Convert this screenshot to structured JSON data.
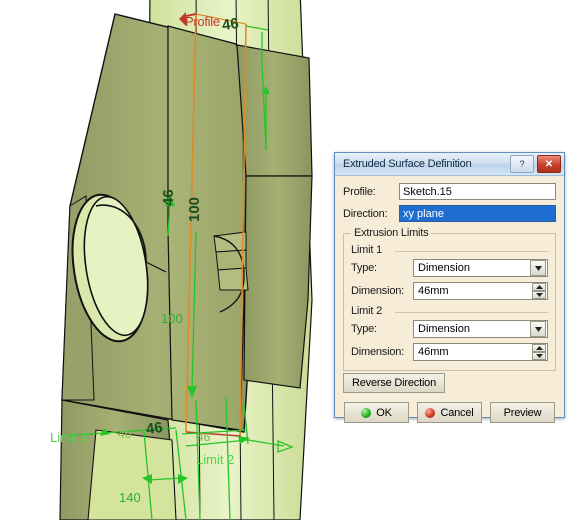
{
  "dialog": {
    "title": "Extruded Surface Definition",
    "help_label": "?",
    "close_label": "✕",
    "profile_label": "Profile:",
    "profile_value": "Sketch.15",
    "direction_label": "Direction:",
    "direction_value": "xy plane",
    "limits_legend": "Extrusion Limits",
    "limit1": {
      "heading": "Limit 1",
      "type_label": "Type:",
      "type_value": "Dimension",
      "dimension_label": "Dimension:",
      "dimension_value": "46mm"
    },
    "limit2": {
      "heading": "Limit 2",
      "type_label": "Type:",
      "type_value": "Dimension",
      "dimension_label": "Dimension:",
      "dimension_value": "46mm"
    },
    "reverse_label": "Reverse Direction",
    "ok_label": "OK",
    "cancel_label": "Cancel",
    "preview_label": "Preview"
  },
  "viewport": {
    "annotations": {
      "profile": "Profile",
      "limit1": "Limit 1",
      "limit2": "Limit 2",
      "dim_100": "100",
      "dim_140": "140",
      "dim_46_left": "46",
      "dim_46_right": "46",
      "handle_mid_a": "46",
      "handle_mid_b": "100",
      "handle_top": "46",
      "handle_bottom": "46"
    }
  },
  "colors": {
    "face_dark": "#9aa46c",
    "face_mid": "#b9c384",
    "face_light": "#d9e7a6",
    "face_pale": "#e6f0bd",
    "sketch_orange": "#e08a2a",
    "annotation_green": "#27c427",
    "annotation_red": "#c0392b",
    "dialog_body": "#f7ecd7",
    "title_blue": "#bdd3ea",
    "select_blue": "#1f6fd0"
  }
}
